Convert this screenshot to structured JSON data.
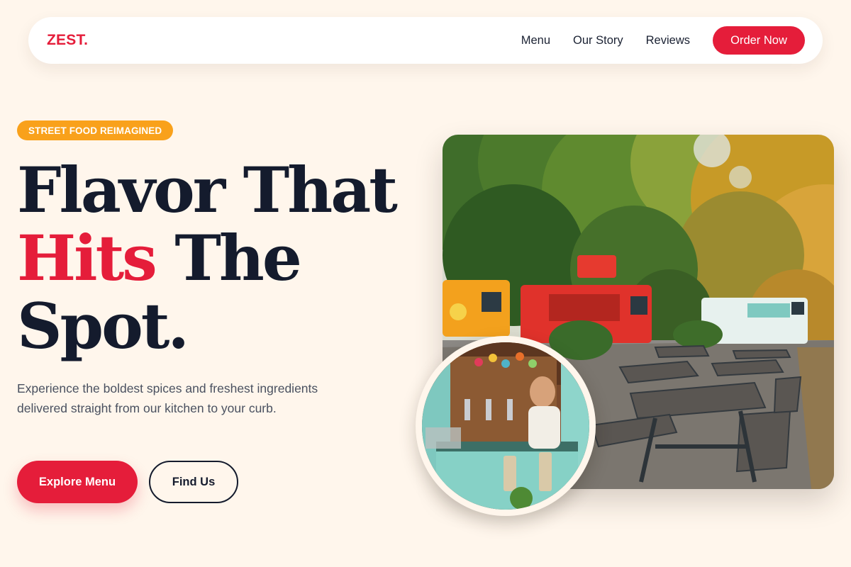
{
  "brand": {
    "logo": "ZEST."
  },
  "nav": {
    "links": [
      "Menu",
      "Our Story",
      "Reviews"
    ],
    "cta": "Order Now"
  },
  "hero": {
    "badge": "STREET FOOD REIMAGINED",
    "headline": {
      "line1": "Flavor That",
      "accent": "Hits",
      "line2_rest": " The",
      "line3": "Spot."
    },
    "description": "Experience the boldest spices and freshest ingredients delivered straight from our kitchen to your curb.",
    "primary_button": "Explore Menu",
    "secondary_button": "Find Us"
  },
  "colors": {
    "background": "#fff6ec",
    "accent": "#e51d3a",
    "badge": "#f9a11b",
    "text_dark": "#141b2d"
  },
  "images": {
    "main": "food-trucks-park-photo",
    "inset": "food-truck-service-window-photo"
  }
}
